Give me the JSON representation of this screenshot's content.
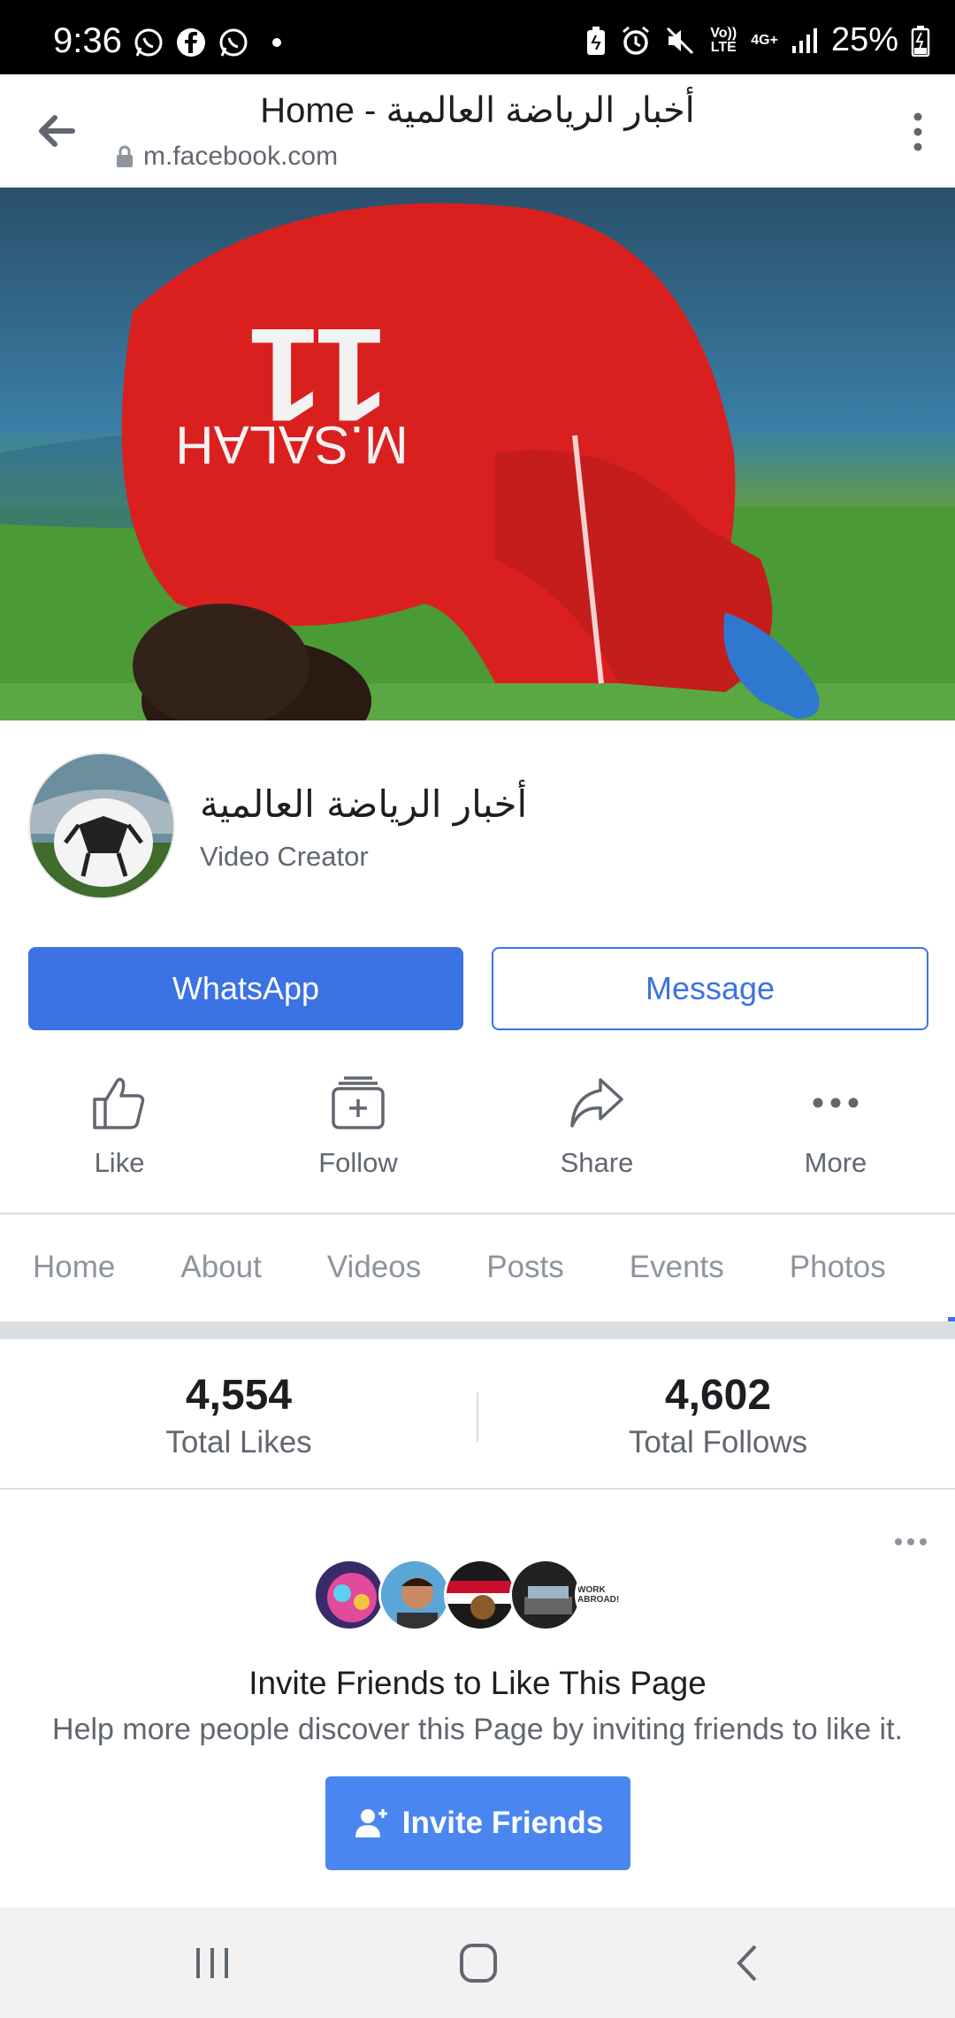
{
  "status_bar": {
    "time": "9:36",
    "battery_percent": "25%",
    "volte_label": "Vo)) LTE",
    "network_label": "4G+"
  },
  "browser": {
    "title": "Home - أخبار الرياضة العالمية",
    "url": "m.facebook.com"
  },
  "page": {
    "name": "أخبار الرياضة العالمية",
    "category": "Video Creator"
  },
  "buttons": {
    "whatsapp": "WhatsApp",
    "message": "Message"
  },
  "actions": [
    {
      "label": "Like",
      "icon": "thumbs-up-icon"
    },
    {
      "label": "Follow",
      "icon": "follow-icon"
    },
    {
      "label": "Share",
      "icon": "share-icon"
    },
    {
      "label": "More",
      "icon": "more-icon"
    }
  ],
  "tabs": [
    "Home",
    "About",
    "Videos",
    "Posts",
    "Events",
    "Photos"
  ],
  "stats": {
    "likes_count": "4,554",
    "likes_label": "Total Likes",
    "follows_count": "4,602",
    "follows_label": "Total Follows"
  },
  "invite": {
    "title": "Invite Friends to Like This Page",
    "subtitle": "Help more people discover this Page by inviting friends to like it.",
    "button": "Invite Friends",
    "last_face_text": "WORK ABROAD!"
  },
  "cover": {
    "jersey_name": "M.SALAH",
    "jersey_number": "11"
  },
  "colors": {
    "accent": "#3b72e4",
    "invite_button": "#4a86f0",
    "jersey": "#d9201f"
  }
}
